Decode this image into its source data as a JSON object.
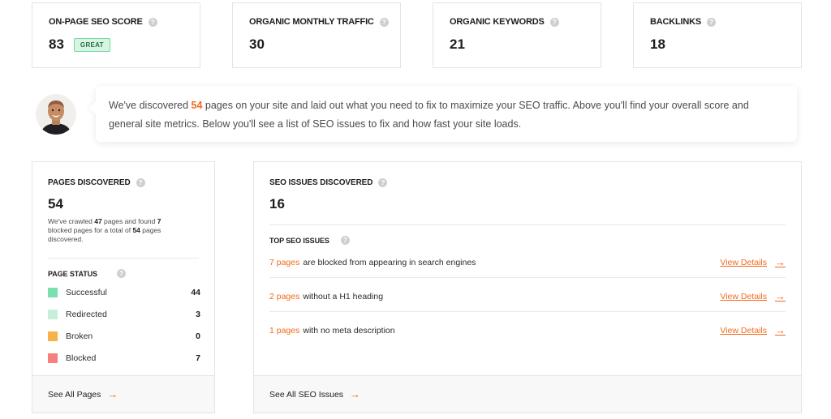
{
  "metrics": [
    {
      "title": "ON-PAGE SEO SCORE",
      "value": "83",
      "badge": "GREAT"
    },
    {
      "title": "ORGANIC MONTHLY TRAFFIC",
      "value": "30"
    },
    {
      "title": "ORGANIC KEYWORDS",
      "value": "21"
    },
    {
      "title": "BACKLINKS",
      "value": "18"
    }
  ],
  "intro": {
    "prefix": "We've discovered ",
    "count": "54",
    "suffix": " pages on your site and laid out what you need to fix to maximize your SEO traffic. Above you'll find your overall score and general site metrics. Below you'll see a list of SEO issues to fix and how fast your site loads."
  },
  "pages": {
    "title": "PAGES DISCOVERED",
    "value": "54",
    "desc_1": "We've crawled ",
    "crawled": "47",
    "desc_2": " pages and found ",
    "blocked": "7",
    "desc_3": " blocked pages for a total of ",
    "total": "54",
    "desc_4": " pages discovered.",
    "status_title": "PAGE STATUS",
    "status": [
      {
        "label": "Successful",
        "count": "44",
        "color": "#7be0b0"
      },
      {
        "label": "Redirected",
        "count": "3",
        "color": "#c7eedb"
      },
      {
        "label": "Broken",
        "count": "0",
        "color": "#f7b24a"
      },
      {
        "label": "Blocked",
        "count": "7",
        "color": "#f77f7f"
      }
    ],
    "footer": "See All Pages"
  },
  "issues": {
    "title": "SEO ISSUES DISCOVERED",
    "value": "16",
    "top_title": "TOP SEO ISSUES",
    "rows": [
      {
        "count": "7 pages",
        "text": "are blocked from appearing in search engines",
        "link": "View Details"
      },
      {
        "count": "2 pages",
        "text": "without a H1 heading",
        "link": "View Details"
      },
      {
        "count": "1 pages",
        "text": "with no meta description",
        "link": "View Details"
      }
    ],
    "footer": "See All SEO Issues"
  },
  "icons": {
    "help": "question-circle-icon",
    "arrow": "arrow-right-icon"
  },
  "colors": {
    "accent": "#f26a1b",
    "badge_bg": "#d6f6e3"
  }
}
